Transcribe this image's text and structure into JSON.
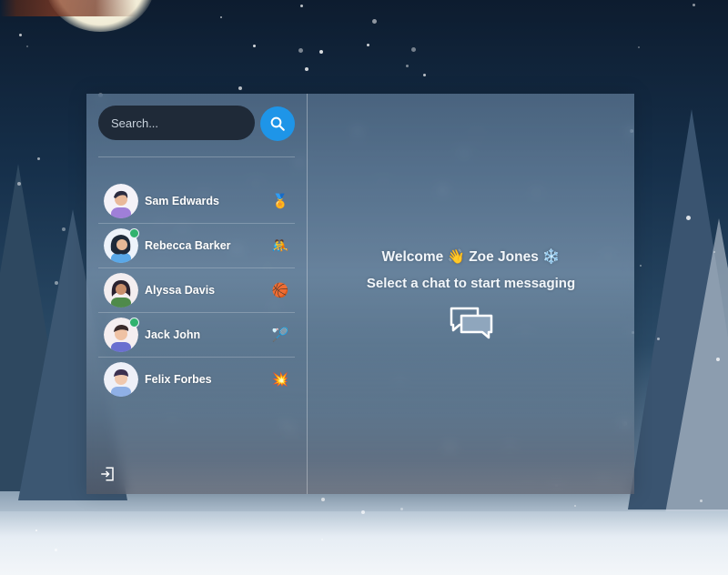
{
  "search": {
    "placeholder": "Search..."
  },
  "users": [
    {
      "name": "Sam Edwards",
      "online": false,
      "icon": "medal-icon",
      "glyph": "🏅"
    },
    {
      "name": "Rebecca Barker",
      "online": true,
      "icon": "wrestling-icon",
      "glyph": "🤼"
    },
    {
      "name": "Alyssa Davis",
      "online": false,
      "icon": "basketball-icon",
      "glyph": "🏀"
    },
    {
      "name": "Jack John",
      "online": true,
      "icon": "badminton-icon",
      "glyph": "🏸"
    },
    {
      "name": "Felix Forbes",
      "online": false,
      "icon": "sparkle-star-icon",
      "glyph": "💥"
    }
  ],
  "welcome": {
    "line1": "Welcome 👋 Zoe Jones ❄️",
    "line2": "Select a chat to start messaging"
  },
  "colors": {
    "accent": "#1e95e8",
    "online": "#31b26e",
    "search_bg": "#1f2a38"
  }
}
